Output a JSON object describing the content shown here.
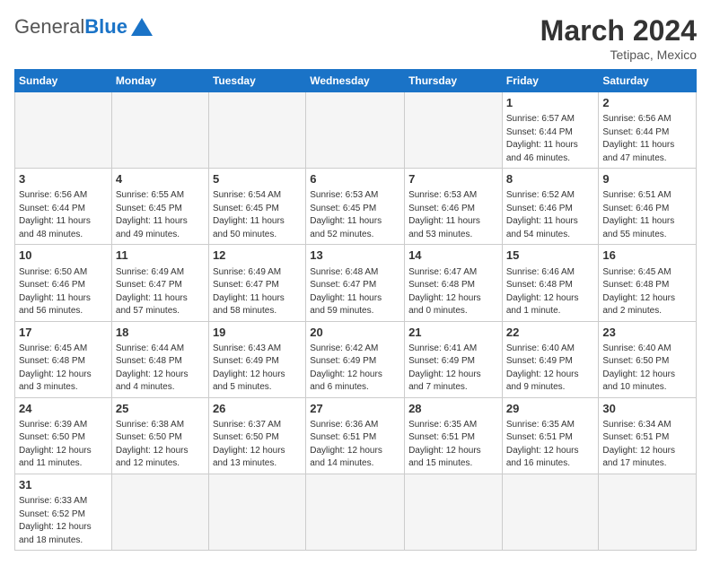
{
  "header": {
    "logo_general": "General",
    "logo_blue": "Blue",
    "month_year": "March 2024",
    "location": "Tetipac, Mexico"
  },
  "weekdays": [
    "Sunday",
    "Monday",
    "Tuesday",
    "Wednesday",
    "Thursday",
    "Friday",
    "Saturday"
  ],
  "weeks": [
    [
      {
        "day": "",
        "info": ""
      },
      {
        "day": "",
        "info": ""
      },
      {
        "day": "",
        "info": ""
      },
      {
        "day": "",
        "info": ""
      },
      {
        "day": "",
        "info": ""
      },
      {
        "day": "1",
        "info": "Sunrise: 6:57 AM\nSunset: 6:44 PM\nDaylight: 11 hours\nand 46 minutes."
      },
      {
        "day": "2",
        "info": "Sunrise: 6:56 AM\nSunset: 6:44 PM\nDaylight: 11 hours\nand 47 minutes."
      }
    ],
    [
      {
        "day": "3",
        "info": "Sunrise: 6:56 AM\nSunset: 6:44 PM\nDaylight: 11 hours\nand 48 minutes."
      },
      {
        "day": "4",
        "info": "Sunrise: 6:55 AM\nSunset: 6:45 PM\nDaylight: 11 hours\nand 49 minutes."
      },
      {
        "day": "5",
        "info": "Sunrise: 6:54 AM\nSunset: 6:45 PM\nDaylight: 11 hours\nand 50 minutes."
      },
      {
        "day": "6",
        "info": "Sunrise: 6:53 AM\nSunset: 6:45 PM\nDaylight: 11 hours\nand 52 minutes."
      },
      {
        "day": "7",
        "info": "Sunrise: 6:53 AM\nSunset: 6:46 PM\nDaylight: 11 hours\nand 53 minutes."
      },
      {
        "day": "8",
        "info": "Sunrise: 6:52 AM\nSunset: 6:46 PM\nDaylight: 11 hours\nand 54 minutes."
      },
      {
        "day": "9",
        "info": "Sunrise: 6:51 AM\nSunset: 6:46 PM\nDaylight: 11 hours\nand 55 minutes."
      }
    ],
    [
      {
        "day": "10",
        "info": "Sunrise: 6:50 AM\nSunset: 6:46 PM\nDaylight: 11 hours\nand 56 minutes."
      },
      {
        "day": "11",
        "info": "Sunrise: 6:49 AM\nSunset: 6:47 PM\nDaylight: 11 hours\nand 57 minutes."
      },
      {
        "day": "12",
        "info": "Sunrise: 6:49 AM\nSunset: 6:47 PM\nDaylight: 11 hours\nand 58 minutes."
      },
      {
        "day": "13",
        "info": "Sunrise: 6:48 AM\nSunset: 6:47 PM\nDaylight: 11 hours\nand 59 minutes."
      },
      {
        "day": "14",
        "info": "Sunrise: 6:47 AM\nSunset: 6:48 PM\nDaylight: 12 hours\nand 0 minutes."
      },
      {
        "day": "15",
        "info": "Sunrise: 6:46 AM\nSunset: 6:48 PM\nDaylight: 12 hours\nand 1 minute."
      },
      {
        "day": "16",
        "info": "Sunrise: 6:45 AM\nSunset: 6:48 PM\nDaylight: 12 hours\nand 2 minutes."
      }
    ],
    [
      {
        "day": "17",
        "info": "Sunrise: 6:45 AM\nSunset: 6:48 PM\nDaylight: 12 hours\nand 3 minutes."
      },
      {
        "day": "18",
        "info": "Sunrise: 6:44 AM\nSunset: 6:48 PM\nDaylight: 12 hours\nand 4 minutes."
      },
      {
        "day": "19",
        "info": "Sunrise: 6:43 AM\nSunset: 6:49 PM\nDaylight: 12 hours\nand 5 minutes."
      },
      {
        "day": "20",
        "info": "Sunrise: 6:42 AM\nSunset: 6:49 PM\nDaylight: 12 hours\nand 6 minutes."
      },
      {
        "day": "21",
        "info": "Sunrise: 6:41 AM\nSunset: 6:49 PM\nDaylight: 12 hours\nand 7 minutes."
      },
      {
        "day": "22",
        "info": "Sunrise: 6:40 AM\nSunset: 6:49 PM\nDaylight: 12 hours\nand 9 minutes."
      },
      {
        "day": "23",
        "info": "Sunrise: 6:40 AM\nSunset: 6:50 PM\nDaylight: 12 hours\nand 10 minutes."
      }
    ],
    [
      {
        "day": "24",
        "info": "Sunrise: 6:39 AM\nSunset: 6:50 PM\nDaylight: 12 hours\nand 11 minutes."
      },
      {
        "day": "25",
        "info": "Sunrise: 6:38 AM\nSunset: 6:50 PM\nDaylight: 12 hours\nand 12 minutes."
      },
      {
        "day": "26",
        "info": "Sunrise: 6:37 AM\nSunset: 6:50 PM\nDaylight: 12 hours\nand 13 minutes."
      },
      {
        "day": "27",
        "info": "Sunrise: 6:36 AM\nSunset: 6:51 PM\nDaylight: 12 hours\nand 14 minutes."
      },
      {
        "day": "28",
        "info": "Sunrise: 6:35 AM\nSunset: 6:51 PM\nDaylight: 12 hours\nand 15 minutes."
      },
      {
        "day": "29",
        "info": "Sunrise: 6:35 AM\nSunset: 6:51 PM\nDaylight: 12 hours\nand 16 minutes."
      },
      {
        "day": "30",
        "info": "Sunrise: 6:34 AM\nSunset: 6:51 PM\nDaylight: 12 hours\nand 17 minutes."
      }
    ],
    [
      {
        "day": "31",
        "info": "Sunrise: 6:33 AM\nSunset: 6:52 PM\nDaylight: 12 hours\nand 18 minutes."
      },
      {
        "day": "",
        "info": ""
      },
      {
        "day": "",
        "info": ""
      },
      {
        "day": "",
        "info": ""
      },
      {
        "day": "",
        "info": ""
      },
      {
        "day": "",
        "info": ""
      },
      {
        "day": "",
        "info": ""
      }
    ]
  ]
}
